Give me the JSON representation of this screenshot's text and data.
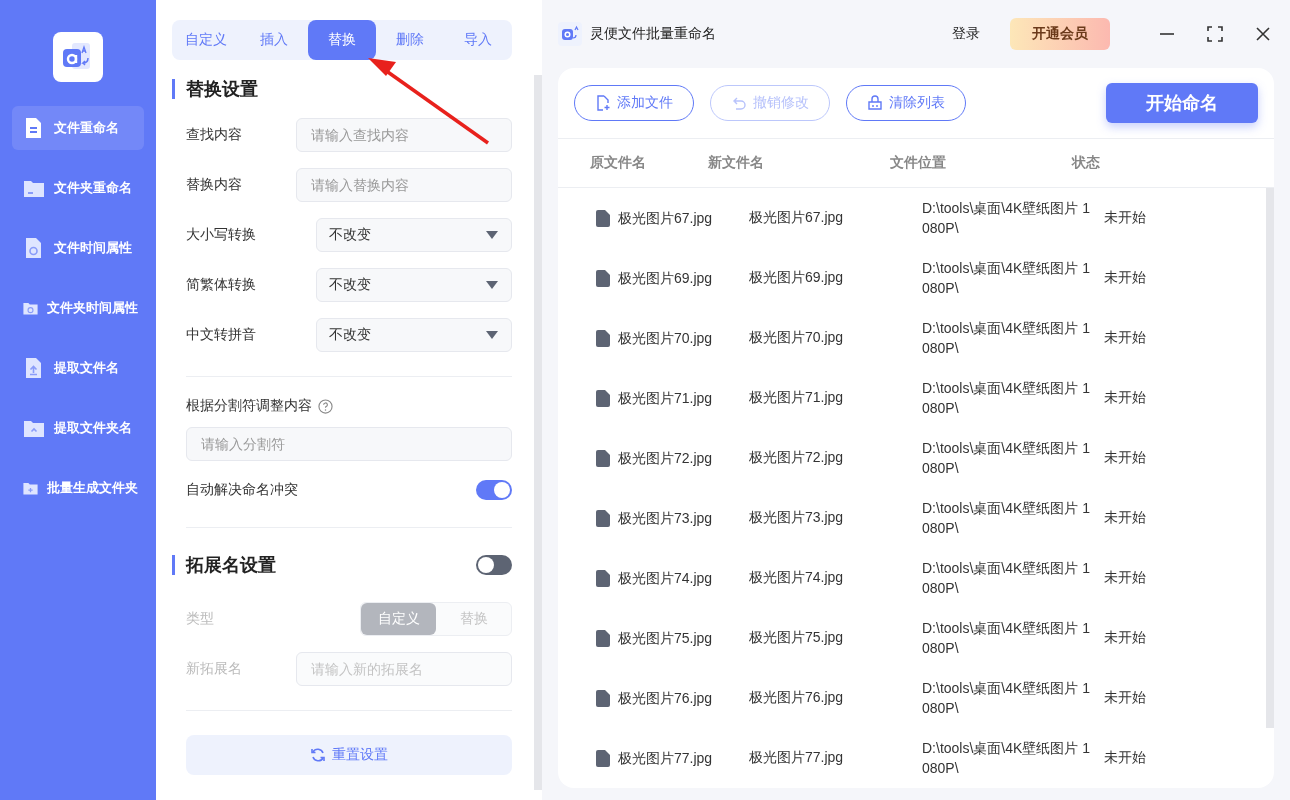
{
  "sidebar": {
    "items": [
      {
        "label": "文件重命名",
        "selected": true
      },
      {
        "label": "文件夹重命名",
        "selected": false
      },
      {
        "label": "文件时间属性",
        "selected": false
      },
      {
        "label": "文件夹时间属性",
        "selected": false
      },
      {
        "label": "提取文件名",
        "selected": false
      },
      {
        "label": "提取文件夹名",
        "selected": false
      },
      {
        "label": "批量生成文件夹",
        "selected": false
      }
    ]
  },
  "settings": {
    "tabs": [
      {
        "label": "自定义",
        "selected": false
      },
      {
        "label": "插入",
        "selected": false
      },
      {
        "label": "替换",
        "selected": true
      },
      {
        "label": "删除",
        "selected": false
      },
      {
        "label": "导入",
        "selected": false
      }
    ],
    "section_title": "替换设置",
    "fields": [
      {
        "kind": "input",
        "label": "查找内容",
        "placeholder": "请输入查找内容"
      },
      {
        "kind": "input",
        "label": "替换内容",
        "placeholder": "请输入替换内容"
      },
      {
        "kind": "select",
        "label": "大小写转换",
        "value": "不改变"
      },
      {
        "kind": "select",
        "label": "简繁体转换",
        "value": "不改变"
      },
      {
        "kind": "select",
        "label": "中文转拼音",
        "value": "不改变"
      }
    ],
    "separator": {
      "label": "根据分割符调整内容",
      "placeholder": "请输入分割符"
    },
    "auto_resolve": {
      "label": "自动解决命名冲突",
      "on": true
    },
    "extension": {
      "title": "拓展名设置",
      "on": false,
      "type_label": "类型",
      "type_options": [
        {
          "label": "自定义",
          "selected": true
        },
        {
          "label": "替换",
          "selected": false
        }
      ],
      "new_label": "新拓展名",
      "placeholder": "请输入新的拓展名",
      "disabled": true
    },
    "reset_button": "重置设置"
  },
  "window": {
    "title": "灵便文件批量重命名",
    "login": "登录",
    "vip": "开通会员"
  },
  "toolbar": {
    "buttons": [
      {
        "label": "添加文件",
        "disabled": false
      },
      {
        "label": "撤销修改",
        "disabled": true
      },
      {
        "label": "清除列表",
        "disabled": false
      }
    ],
    "start": "开始命名"
  },
  "table": {
    "columns": [
      "原文件名",
      "新文件名",
      "文件位置",
      "状态"
    ],
    "rows": [
      {
        "original": "极光图片67.jpg",
        "new": "极光图片67.jpg",
        "location": "D:\\tools\\桌面\\4K壁纸图片 1080P\\",
        "status": "未开始"
      },
      {
        "original": "极光图片69.jpg",
        "new": "极光图片69.jpg",
        "location": "D:\\tools\\桌面\\4K壁纸图片 1080P\\",
        "status": "未开始"
      },
      {
        "original": "极光图片70.jpg",
        "new": "极光图片70.jpg",
        "location": "D:\\tools\\桌面\\4K壁纸图片 1080P\\",
        "status": "未开始"
      },
      {
        "original": "极光图片71.jpg",
        "new": "极光图片71.jpg",
        "location": "D:\\tools\\桌面\\4K壁纸图片 1080P\\",
        "status": "未开始"
      },
      {
        "original": "极光图片72.jpg",
        "new": "极光图片72.jpg",
        "location": "D:\\tools\\桌面\\4K壁纸图片 1080P\\",
        "status": "未开始"
      },
      {
        "original": "极光图片73.jpg",
        "new": "极光图片73.jpg",
        "location": "D:\\tools\\桌面\\4K壁纸图片 1080P\\",
        "status": "未开始"
      },
      {
        "original": "极光图片74.jpg",
        "new": "极光图片74.jpg",
        "location": "D:\\tools\\桌面\\4K壁纸图片 1080P\\",
        "status": "未开始"
      },
      {
        "original": "极光图片75.jpg",
        "new": "极光图片75.jpg",
        "location": "D:\\tools\\桌面\\4K壁纸图片 1080P\\",
        "status": "未开始"
      },
      {
        "original": "极光图片76.jpg",
        "new": "极光图片76.jpg",
        "location": "D:\\tools\\桌面\\4K壁纸图片 1080P\\",
        "status": "未开始"
      },
      {
        "original": "极光图片77.jpg",
        "new": "极光图片77.jpg",
        "location": "D:\\tools\\桌面\\4K壁纸图片 1080P\\",
        "status": "未开始"
      }
    ]
  }
}
